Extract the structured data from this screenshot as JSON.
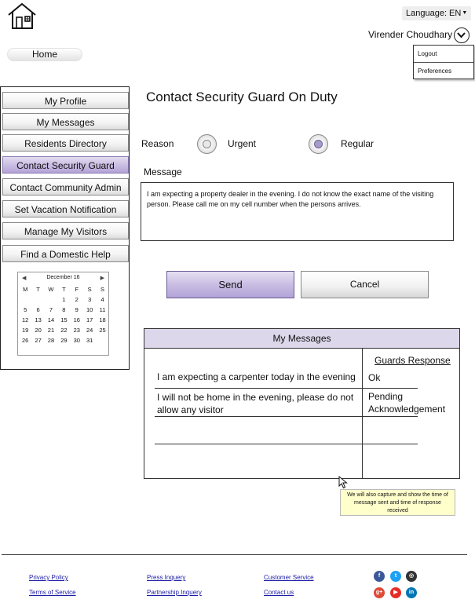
{
  "header": {
    "language_label": "Language: EN",
    "user_name": "Virender Choudhary",
    "user_menu": [
      "Logout",
      "Preferences"
    ],
    "home_tab": "Home"
  },
  "sidebar": {
    "items": [
      {
        "label": "My Profile"
      },
      {
        "label": "My Messages"
      },
      {
        "label": "Residents Directory"
      },
      {
        "label": "Contact Security Guard",
        "active": true
      },
      {
        "label": "Contact Community Admin"
      },
      {
        "label": "Set Vacation Notification"
      },
      {
        "label": "Manage My Visitors"
      },
      {
        "label": "Find a Domestic Help"
      }
    ]
  },
  "calendar": {
    "title": "December 16",
    "weekdays": [
      "M",
      "T",
      "W",
      "T",
      "F",
      "S",
      "S"
    ],
    "weeks": [
      [
        "",
        "",
        "",
        "1",
        "2",
        "3",
        "4"
      ],
      [
        "5",
        "6",
        "7",
        "8",
        "9",
        "10",
        "11"
      ],
      [
        "12",
        "13",
        "14",
        "15",
        "16",
        "17",
        "18"
      ],
      [
        "19",
        "20",
        "21",
        "22",
        "23",
        "24",
        "25"
      ],
      [
        "26",
        "27",
        "28",
        "29",
        "30",
        "31",
        ""
      ]
    ]
  },
  "form": {
    "title": "Contact Security Guard On Duty",
    "reason_label": "Reason",
    "reason_options": [
      {
        "label": "Urgent",
        "selected": false
      },
      {
        "label": "Regular",
        "selected": true
      }
    ],
    "message_label": "Message",
    "message_value": "I am expecting a property dealer in the evening. I do not know the exact name of the visiting person. Please call me on my cell number when the persons arrives.",
    "send_label": "Send",
    "cancel_label": "Cancel"
  },
  "messages": {
    "title": "My Messages",
    "response_header": "Guards Response",
    "rows": [
      {
        "message": "I am expecting a carpenter today in the evening",
        "response": "Ok"
      },
      {
        "message": "I will not be home in the evening, please do not allow any visitor",
        "response": "Pending Acknowledgement"
      }
    ]
  },
  "tooltip": "We will also capture and show the time of message sent and time of response received",
  "footer": {
    "links": [
      "Privacy Policy",
      "Terms of Service",
      "Press Inquery",
      "Partnership Inquery",
      "Customer Service",
      "Contact us"
    ],
    "social": [
      {
        "icon": "facebook-icon",
        "glyph": "f",
        "color": "#3b5998"
      },
      {
        "icon": "twitter-icon",
        "glyph": "t",
        "color": "#1da1f2"
      },
      {
        "icon": "instagram-icon",
        "glyph": "◎",
        "color": "#333333"
      },
      {
        "icon": "google-plus-icon",
        "glyph": "g+",
        "color": "#dd4b39"
      },
      {
        "icon": "youtube-icon",
        "glyph": "▶",
        "color": "#e52d27"
      },
      {
        "icon": "linkedin-icon",
        "glyph": "in",
        "color": "#0077b5"
      }
    ]
  }
}
